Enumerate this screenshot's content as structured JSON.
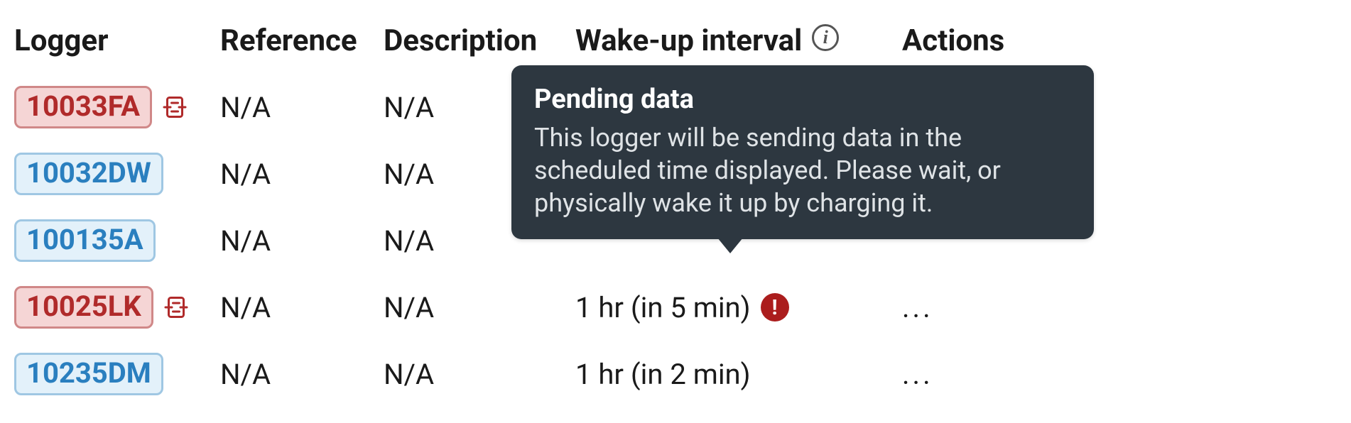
{
  "columns": {
    "logger": "Logger",
    "reference": "Reference",
    "description": "Description",
    "wakeup": "Wake-up interval",
    "actions": "Actions"
  },
  "tooltip": {
    "title": "Pending data",
    "body": "This logger will be sending data in the scheduled time displayed. Please wait, or physically wake it up by charging it."
  },
  "rows": [
    {
      "id": "10033FA",
      "variant": "red",
      "warn": true,
      "reference": "N/A",
      "description": "N/A",
      "wakeup": "",
      "alert": false,
      "actions": ""
    },
    {
      "id": "10032DW",
      "variant": "blue",
      "warn": false,
      "reference": "N/A",
      "description": "N/A",
      "wakeup": "",
      "alert": false,
      "actions": ""
    },
    {
      "id": "100135A",
      "variant": "blue",
      "warn": false,
      "reference": "N/A",
      "description": "N/A",
      "wakeup": "",
      "alert": false,
      "actions": ""
    },
    {
      "id": "10025LK",
      "variant": "red",
      "warn": true,
      "reference": "N/A",
      "description": "N/A",
      "wakeup": "1 hr (in 5 min)",
      "alert": true,
      "actions": "..."
    },
    {
      "id": "10235DM",
      "variant": "blue",
      "warn": false,
      "reference": "N/A",
      "description": "N/A",
      "wakeup": "1 hr (in 2 min)",
      "alert": false,
      "actions": "..."
    }
  ],
  "icons": {
    "info_glyph": "i"
  }
}
